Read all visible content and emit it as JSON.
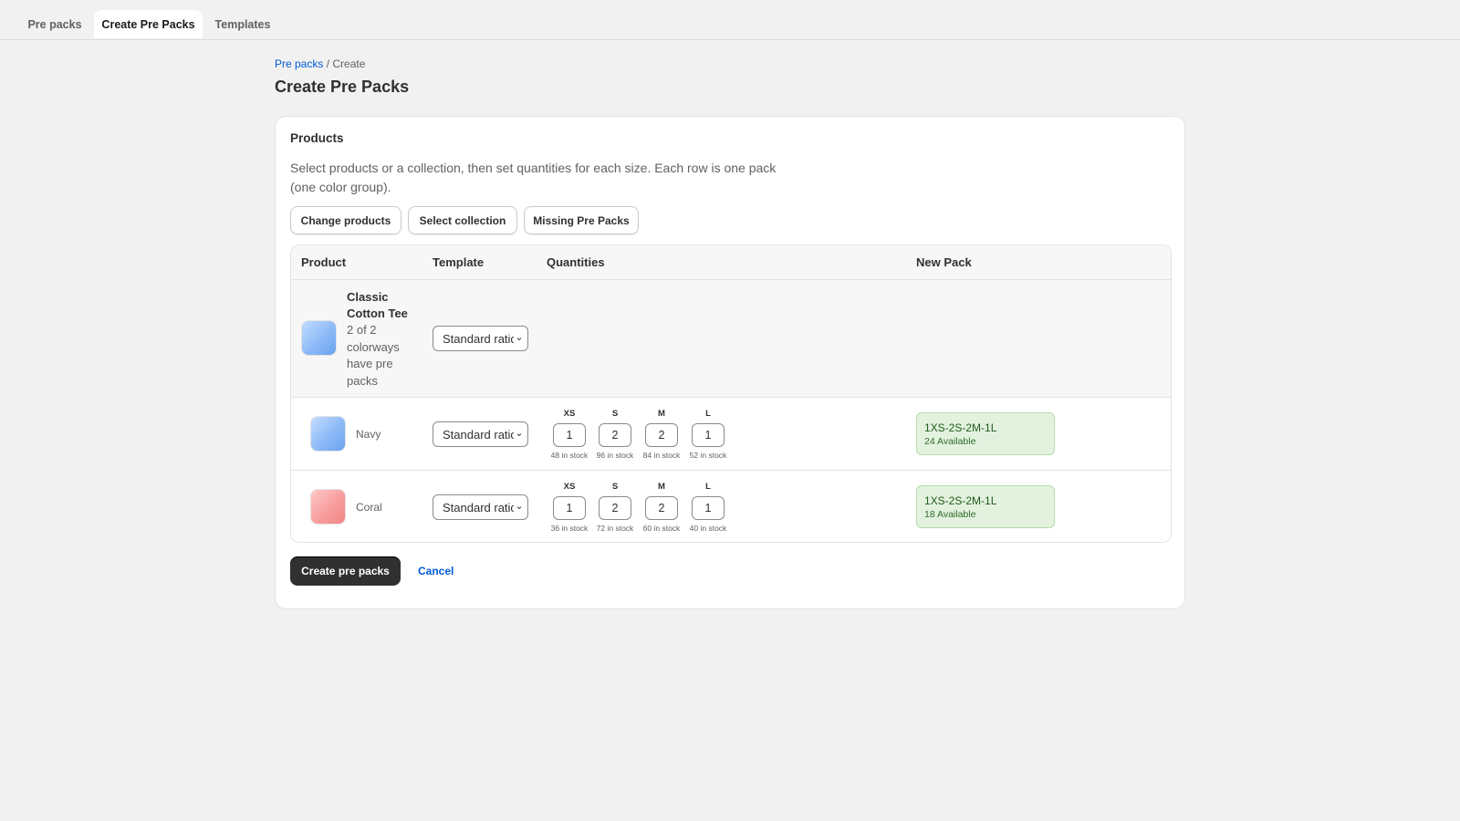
{
  "tabs": [
    {
      "label": "Pre packs",
      "active": false
    },
    {
      "label": "Create Pre Packs",
      "active": true
    },
    {
      "label": "Templates",
      "active": false
    }
  ],
  "breadcrumb": {
    "link": "Pre packs",
    "separator": " / ",
    "current": "Create"
  },
  "page_title": "Create Pre Packs",
  "card": {
    "heading": "Products",
    "description": "Select products or a collection, then set quantities for each size. Each row is one pack (one color group).",
    "buttons": {
      "change_products": "Change products",
      "select_collection": "Select collection",
      "missing_pre_packs": "Missing Pre Packs"
    }
  },
  "table": {
    "headers": {
      "product": "Product",
      "template": "Template",
      "quantities": "Quantities",
      "new_pack": "New Pack"
    },
    "parent": {
      "name": "Classic Cotton Tee",
      "subtitle": "2 of 2 colorways have pre packs",
      "template": "Standard ratio",
      "thumb_color": "#8cbaf7"
    },
    "rows": [
      {
        "color": "Navy",
        "thumb_color": "#8cbaf7",
        "template": "Standard ratio",
        "sizes": [
          {
            "size": "XS",
            "qty": "1",
            "stock": "48 in stock"
          },
          {
            "size": "S",
            "qty": "2",
            "stock": "96 in stock"
          },
          {
            "size": "M",
            "qty": "2",
            "stock": "84 in stock"
          },
          {
            "size": "L",
            "qty": "1",
            "stock": "52 in stock"
          }
        ],
        "new_pack": {
          "code": "1XS-2S-2M-1L",
          "available": "24 Available"
        }
      },
      {
        "color": "Coral",
        "thumb_color": "#f79d9d",
        "template": "Standard ratio",
        "sizes": [
          {
            "size": "XS",
            "qty": "1",
            "stock": "36 in stock"
          },
          {
            "size": "S",
            "qty": "2",
            "stock": "72 in stock"
          },
          {
            "size": "M",
            "qty": "2",
            "stock": "60 in stock"
          },
          {
            "size": "L",
            "qty": "1",
            "stock": "40 in stock"
          }
        ],
        "new_pack": {
          "code": "1XS-2S-2M-1L",
          "available": "18 Available"
        }
      }
    ]
  },
  "actions": {
    "primary": "Create pre packs",
    "cancel": "Cancel"
  },
  "icons": {
    "select_chevron": "chevron-down-icon"
  },
  "colors": {
    "accent_link": "#005bd3",
    "primary_button": "#303030",
    "success_bg": "#e3f2df"
  }
}
